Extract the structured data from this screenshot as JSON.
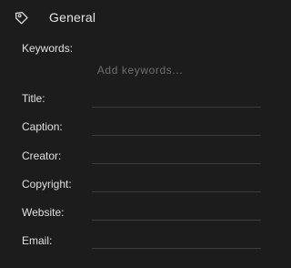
{
  "header": {
    "icon": "tag-icon",
    "title": "General"
  },
  "keywords": {
    "label": "Keywords:",
    "placeholder": "Add keywords...",
    "value": ""
  },
  "fields": {
    "title": {
      "label": "Title:",
      "value": ""
    },
    "caption": {
      "label": "Caption:",
      "value": ""
    },
    "creator": {
      "label": "Creator:",
      "value": ""
    },
    "copyright": {
      "label": "Copyright:",
      "value": ""
    },
    "website": {
      "label": "Website:",
      "value": ""
    },
    "email": {
      "label": "Email:",
      "value": ""
    }
  },
  "colors": {
    "background": "#1c1c1c",
    "text": "#e0e0e0",
    "placeholder": "#6e6e6e",
    "divider": "#3c3c3c"
  }
}
